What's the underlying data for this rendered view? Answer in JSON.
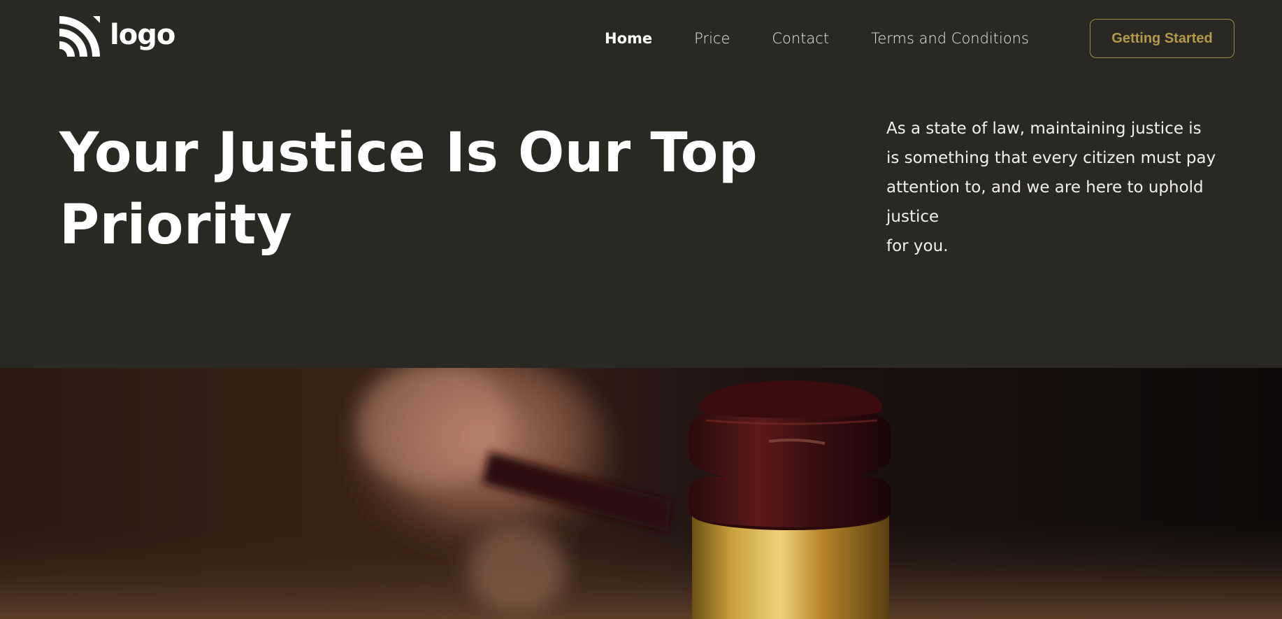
{
  "header": {
    "logo_text": "logo",
    "logo_icon": "wifi-signal-icon",
    "nav": [
      {
        "label": "Home",
        "active": true
      },
      {
        "label": "Price",
        "active": false
      },
      {
        "label": "Contact",
        "active": false
      },
      {
        "label": "Terms and Conditions",
        "active": false
      }
    ],
    "cta_label": "Getting Started"
  },
  "hero": {
    "title_line1": "Your Justice Is Our Top",
    "title_line2": "Priority",
    "description_lines": [
      "As a state of law, maintaining justice is",
      "is something that every citizen must pay",
      "attention to, and we are here to uphold",
      "justice",
      "for you."
    ]
  },
  "image": {
    "subject": "gavel-photo"
  },
  "colors": {
    "background": "#2a2823",
    "accent": "#b39a4a",
    "text": "#ffffff"
  }
}
